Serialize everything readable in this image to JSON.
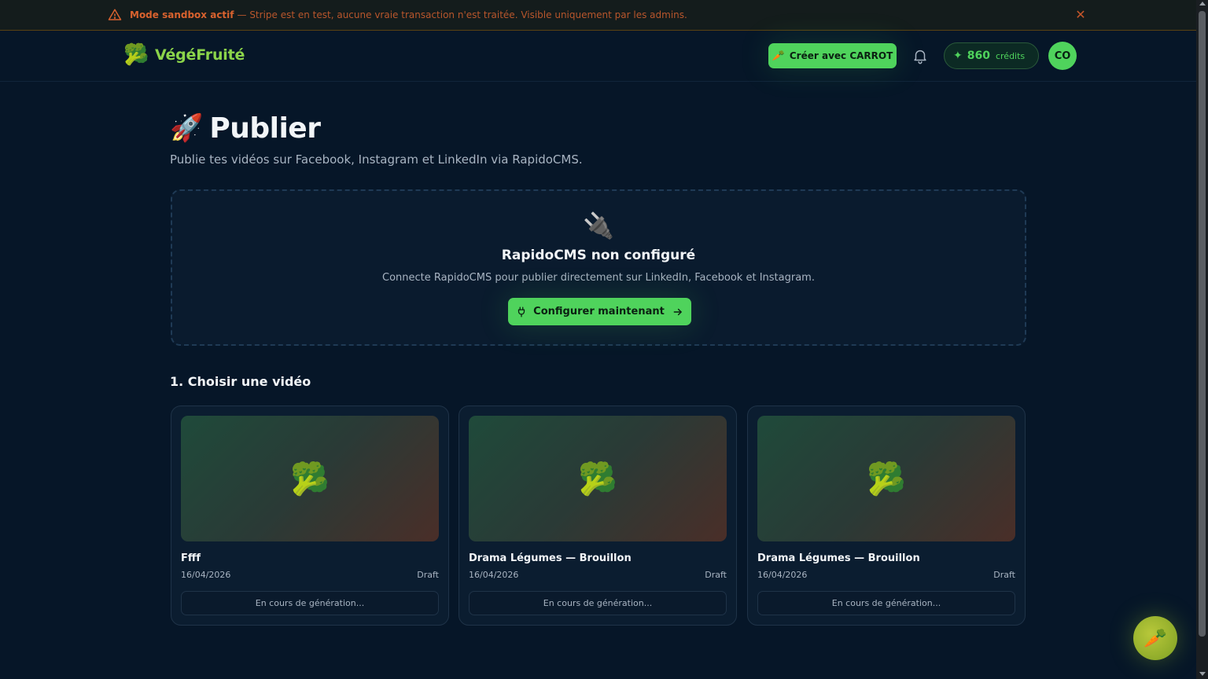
{
  "sandbox": {
    "strong": "Mode sandbox actif",
    "message": "— Stripe est en test, aucune vraie transaction n'est traitée. Visible uniquement par les admins.",
    "close_glyph": "✕"
  },
  "header": {
    "logo_glyph": "🥦",
    "brand": "VégéFruité",
    "create_button": "Créer avec CARROT",
    "create_icon": "🥕",
    "credits_value": "860",
    "credits_label": "crédits",
    "credits_icon": "✦",
    "avatar_initials": "CO"
  },
  "page": {
    "title_icon": "🚀",
    "title": "Publier",
    "subtitle": "Publie tes vidéos sur Facebook, Instagram et LinkedIn via RapidoCMS."
  },
  "cms": {
    "icon": "🔌",
    "heading": "RapidoCMS non configuré",
    "description": "Connecte RapidoCMS pour publier directement sur LinkedIn, Facebook et Instagram.",
    "button": "Configurer maintenant"
  },
  "section": {
    "title": "1. Choisir une vidéo"
  },
  "videos": [
    {
      "thumb": "🥦",
      "title": "Ffff",
      "date": "16/04/2026",
      "status": "Draft",
      "action": "En cours de génération..."
    },
    {
      "thumb": "🥦",
      "title": "Drama Légumes — Brouillon",
      "date": "16/04/2026",
      "status": "Draft",
      "action": "En cours de génération..."
    },
    {
      "thumb": "🥦",
      "title": "Drama Légumes — Brouillon",
      "date": "16/04/2026",
      "status": "Draft",
      "action": "En cours de génération..."
    }
  ],
  "fab": {
    "icon": "🥕"
  },
  "colors": {
    "accent": "#4fd35c",
    "background": "#061628",
    "warning": "#d9622e",
    "brand": "#8bd44a"
  }
}
